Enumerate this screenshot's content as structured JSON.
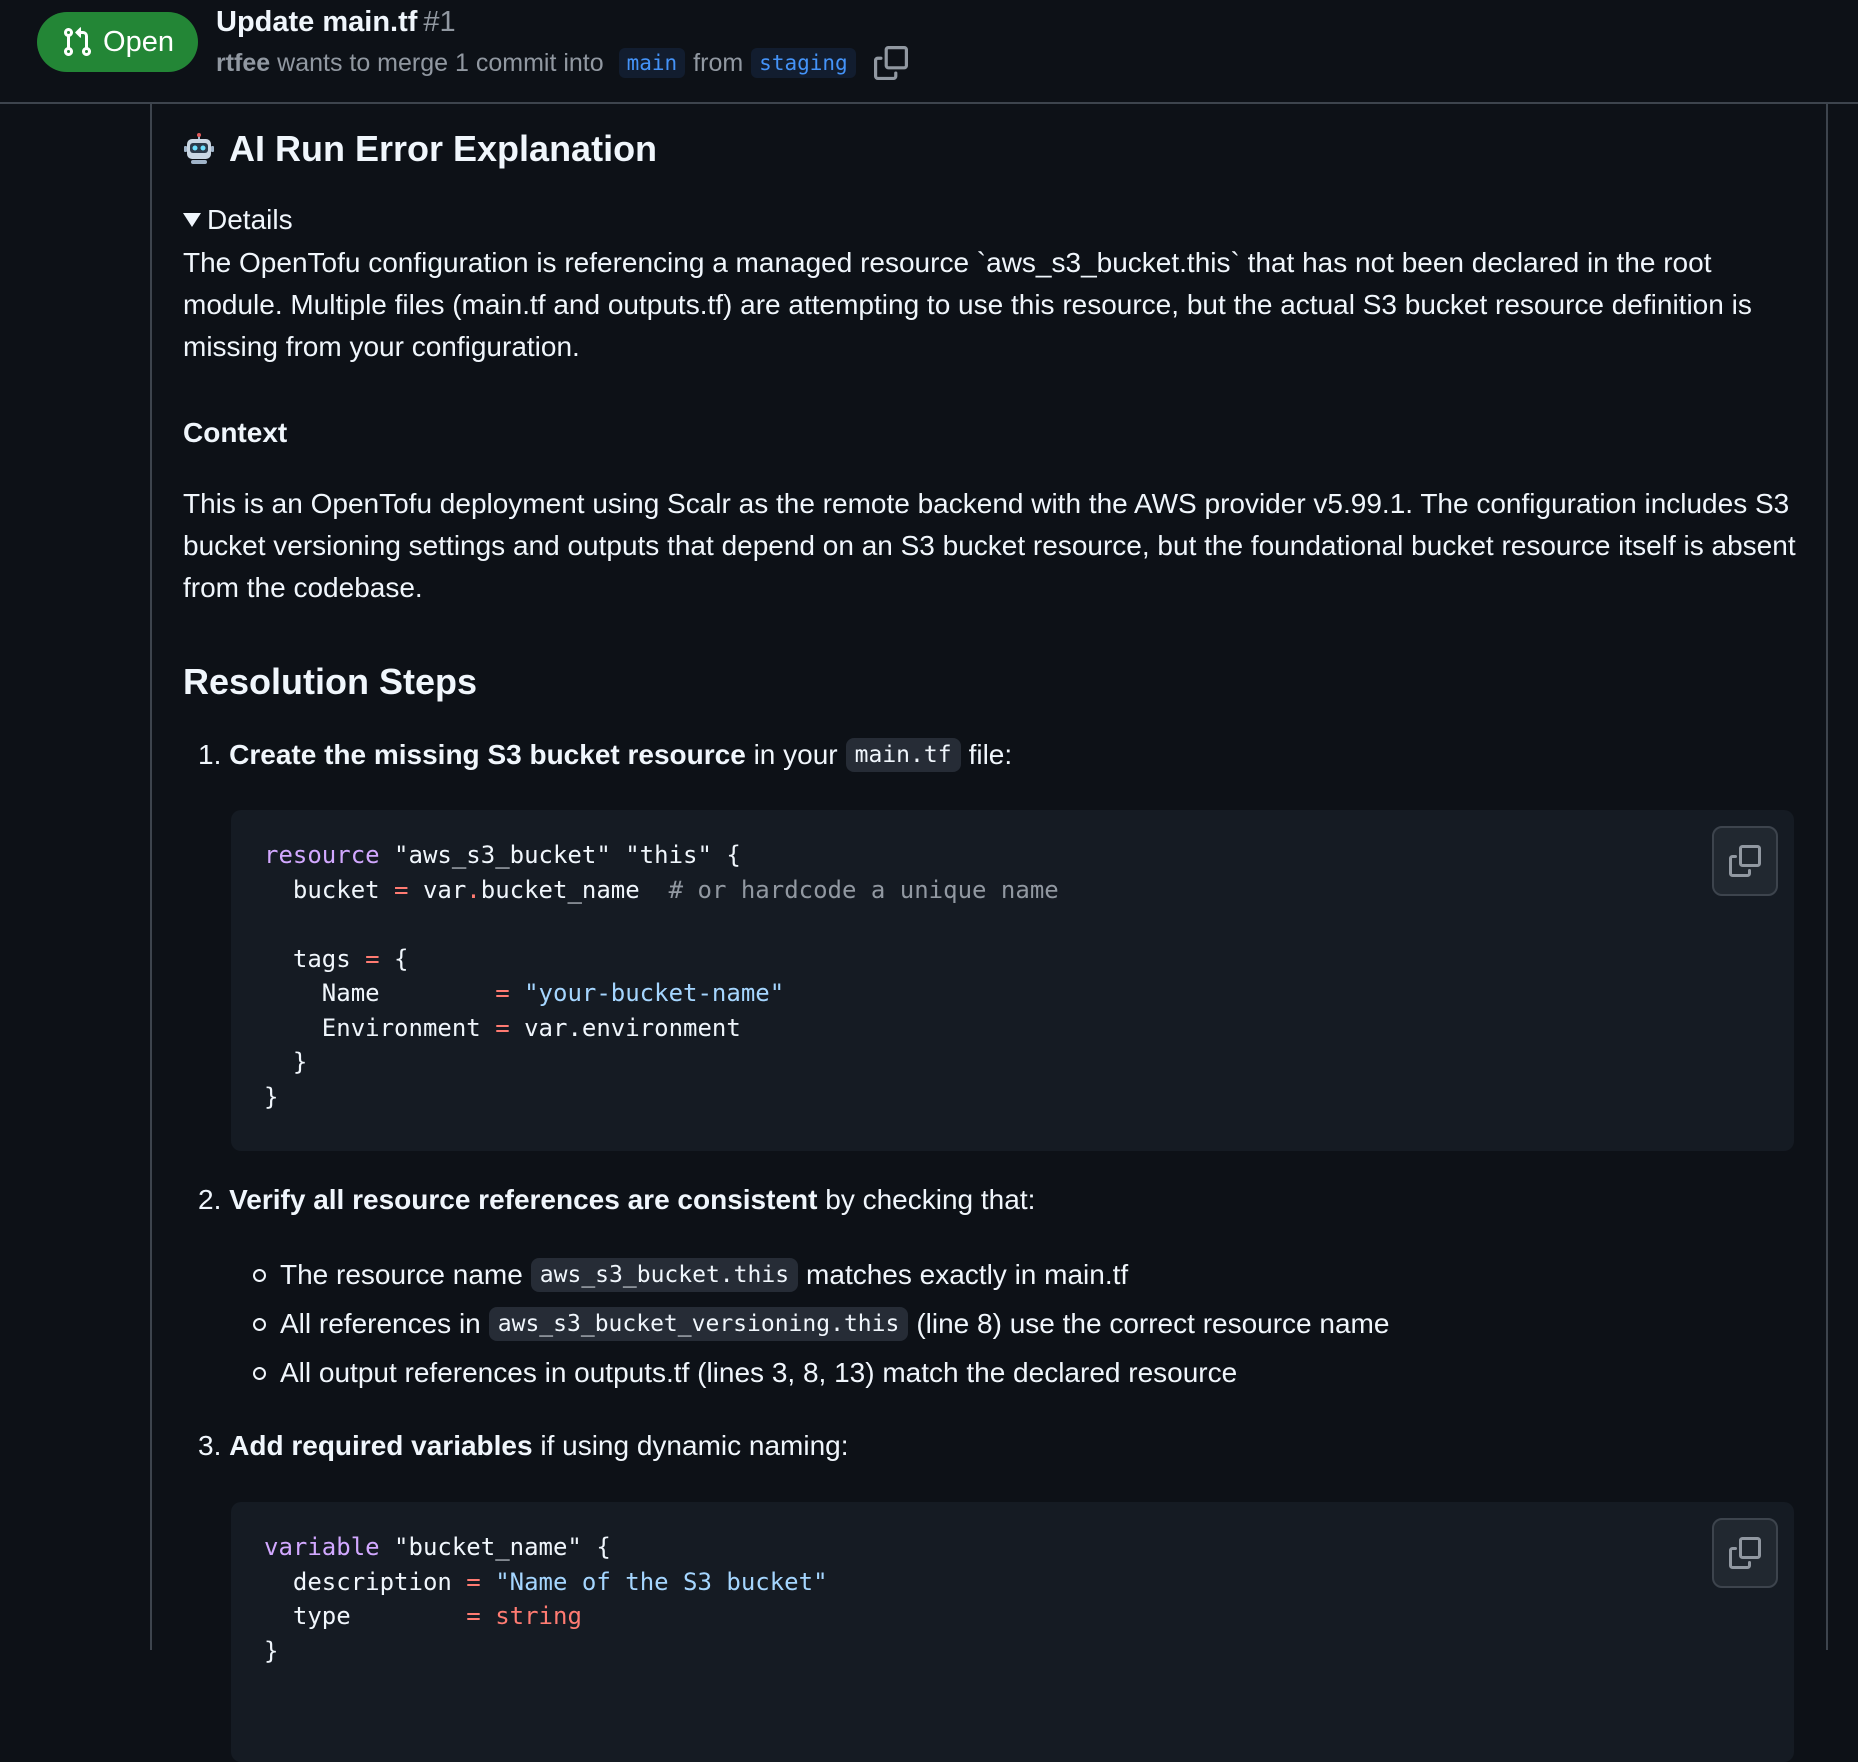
{
  "header": {
    "state_label": "Open",
    "title": "Update main.tf",
    "number": "#1",
    "author": "rtfee",
    "meta_text": " wants to merge 1 commit into ",
    "base_branch": "main",
    "from_text": "from",
    "head_branch": "staging"
  },
  "comment": {
    "heading": "AI Run Error Explanation",
    "details_label": "Details",
    "intro": "The OpenTofu configuration is referencing a managed resource `aws_s3_bucket.this` that has not been declared in the root module. Multiple files (main.tf and outputs.tf) are attempting to use this resource, but the actual S3 bucket resource definition is missing from your configuration.",
    "context_heading": "Context",
    "context_text": "This is an OpenTofu deployment using Scalr as the remote backend with the AWS provider v5.99.1. The configuration includes S3 bucket versioning settings and outputs that depend on an S3 bucket resource, but the foundational bucket resource itself is absent from the codebase.",
    "resolution_heading": "Resolution Steps",
    "step1": {
      "num": "1.",
      "bold": "Create the missing S3 bucket resource",
      "mid": " in your",
      "code": "main.tf",
      "end": "file:"
    },
    "code1": {
      "l1_kw": "resource",
      "l1_rest": " \"aws_s3_bucket\" \"this\" {",
      "l2_a": "  bucket ",
      "l2_op": "=",
      "l2_b": " var",
      "l2_dot": ".",
      "l2_c": "bucket_name  ",
      "l2_cm": "# or hardcode a unique name",
      "l4_a": "  tags ",
      "l4_op": "=",
      "l4_b": " {",
      "l5_a": "    Name        ",
      "l5_op": "=",
      "l5_str": " \"your-bucket-name\"",
      "l6_a": "    Environment ",
      "l6_op": "=",
      "l6_b": " var.environment",
      "l7": "  }",
      "l8": "}"
    },
    "step2": {
      "num": "2.",
      "bold": "Verify all resource references are consistent",
      "rest": " by checking that:"
    },
    "sub": [
      {
        "pre": "The resource name",
        "code": "aws_s3_bucket.this",
        "post": "matches exactly in main.tf"
      },
      {
        "pre": "All references in",
        "code": "aws_s3_bucket_versioning.this",
        "post": "(line 8) use the correct resource name"
      },
      {
        "pre": "All output references in outputs.tf (lines 3, 8, 13) match the declared resource",
        "code": "",
        "post": ""
      }
    ],
    "step3": {
      "num": "3.",
      "bold": "Add required variables",
      "rest": " if using dynamic naming:"
    },
    "code2": {
      "l1_kw": "variable",
      "l1_rest": " \"bucket_name\" {",
      "l2_a": "  description ",
      "l2_op": "=",
      "l2_str": " \"Name of the S3 bucket\"",
      "l3_a": "  type        ",
      "l3_op": "=",
      "l3_kw": " string",
      "l4": "}"
    }
  },
  "colors": {
    "background": "#0d1117",
    "open_badge": "#238636",
    "branch": "#4493f8",
    "keyword": "#d2a8ff",
    "string": "#a5d6ff",
    "operator": "#ff7b72"
  }
}
